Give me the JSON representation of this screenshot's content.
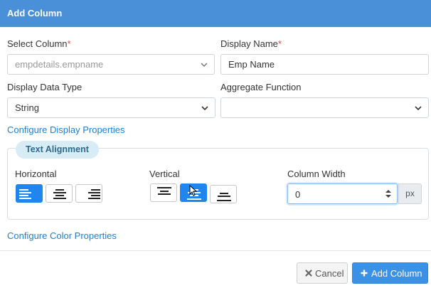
{
  "dialog": {
    "title": "Add Column"
  },
  "form": {
    "select_column": {
      "label": "Select Column",
      "required_mark": "*",
      "value": "empdetails.empname"
    },
    "display_name": {
      "label": "Display Name",
      "required_mark": "*",
      "value": "Emp Name"
    },
    "display_data_type": {
      "label": "Display Data Type",
      "value": "String"
    },
    "aggregate_function": {
      "label": "Aggregate Function",
      "value": ""
    },
    "configure_display_link": "Configure Display Properties",
    "configure_color_link": "Configure Color Properties"
  },
  "text_alignment": {
    "legend": "Text Alignment",
    "horizontal_label": "Horizontal",
    "horizontal_selected": "left",
    "vertical_label": "Vertical",
    "vertical_selected": "middle",
    "column_width_label": "Column Width",
    "column_width_value": "0",
    "column_width_unit": "px"
  },
  "footer": {
    "cancel_label": "Cancel",
    "add_label": "Add Column"
  },
  "icons": {
    "cancel": "times-icon",
    "add": "plus-icon",
    "dropdown": "chevron-down-icon"
  },
  "colors": {
    "header": "#4a90d9",
    "accent": "#1f86f0",
    "link": "#1e7fd1",
    "required": "#d9534f"
  }
}
